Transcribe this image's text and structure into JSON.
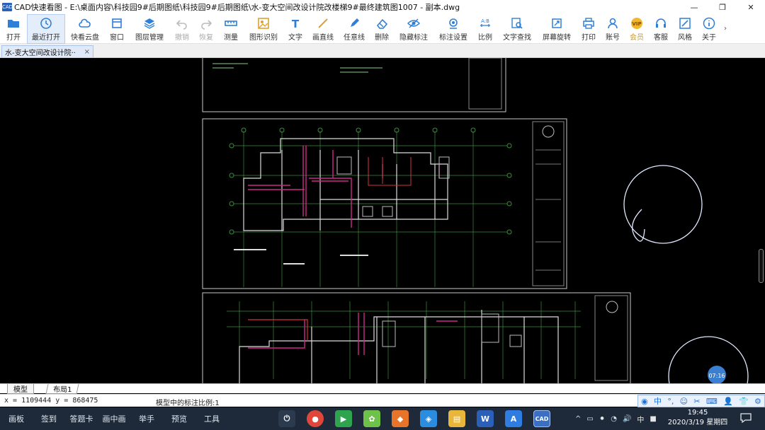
{
  "window": {
    "app_icon_label": "CAD",
    "title": "CAD快速看图 - E:\\桌面内容\\科技园9#后期图纸\\科技园9#后期图纸\\水-变大空间改设计院改楼梯9#最终建筑图1007 - 副本.dwg",
    "minimize": "—",
    "restore": "❐",
    "close": "✕"
  },
  "toolbar": {
    "items": [
      {
        "label": "打开",
        "icon": "folder-icon"
      },
      {
        "label": "最近打开",
        "icon": "clock-icon"
      },
      {
        "label": "快看云盘",
        "icon": "cloud-icon"
      },
      {
        "label": "窗口",
        "icon": "window-icon"
      },
      {
        "label": "图层管理",
        "icon": "layers-icon"
      },
      {
        "label": "撤销",
        "icon": "undo-icon"
      },
      {
        "label": "恢复",
        "icon": "redo-icon"
      },
      {
        "label": "测量",
        "icon": "ruler-icon"
      },
      {
        "label": "图形识别",
        "icon": "shape-recognize-icon"
      },
      {
        "label": "文字",
        "icon": "text-icon"
      },
      {
        "label": "画直线",
        "icon": "line-icon"
      },
      {
        "label": "任意线",
        "icon": "pen-icon"
      },
      {
        "label": "删除",
        "icon": "eraser-icon"
      },
      {
        "label": "隐藏标注",
        "icon": "eye-hide-icon"
      },
      {
        "label": "标注设置",
        "icon": "annotation-settings-icon"
      },
      {
        "label": "比例",
        "icon": "scale-icon"
      },
      {
        "label": "文字查找",
        "icon": "text-search-icon"
      },
      {
        "label": "屏幕旋转",
        "icon": "rotate-screen-icon"
      },
      {
        "label": "打印",
        "icon": "printer-icon"
      },
      {
        "label": "账号",
        "icon": "user-icon"
      },
      {
        "label": "会员",
        "icon": "vip-icon"
      },
      {
        "label": "客服",
        "icon": "headset-icon"
      },
      {
        "label": "风格",
        "icon": "style-icon"
      },
      {
        "label": "关于",
        "icon": "info-icon"
      }
    ],
    "more": "›",
    "scale_badge": "A:B",
    "vip_badge": "VIP",
    "text_glyph": "T"
  },
  "doc_tab": {
    "label": "水-变大空间改设计院··",
    "close": "×"
  },
  "layout_tabs": {
    "model": "模型",
    "layout1": "布局1"
  },
  "status": {
    "coords": "x = 1109444  y = 868475",
    "scale_text": "模型中的标注比例:1"
  },
  "ime_bar": {
    "lang": "中",
    "punct": "°,",
    "emoji": "☺"
  },
  "canvas": {
    "badge": "07:16"
  },
  "taskbar": {
    "items": [
      "画板",
      "签到",
      "答题卡",
      "画中画",
      "举手",
      "预览",
      "工具"
    ],
    "apps": [
      {
        "name": "power",
        "glyph": "⏻",
        "color": "#2b3a4f"
      },
      {
        "name": "chrome",
        "glyph": "●",
        "color": "#e0463a"
      },
      {
        "name": "media",
        "glyph": "▶",
        "color": "#2ea44f"
      },
      {
        "name": "flower",
        "glyph": "✿",
        "color": "#6ec24a"
      },
      {
        "name": "app-orange",
        "glyph": "◆",
        "color": "#e8742a"
      },
      {
        "name": "app-blue",
        "glyph": "◈",
        "color": "#2b8de0"
      },
      {
        "name": "explorer",
        "glyph": "▤",
        "color": "#e8b63a"
      },
      {
        "name": "word",
        "glyph": "W",
        "color": "#2b5fb8"
      },
      {
        "name": "app-a",
        "glyph": "A",
        "color": "#2f7de0"
      },
      {
        "name": "cad",
        "glyph": "CAD",
        "color": "#3a6fc4"
      }
    ],
    "tray": [
      "^",
      "▭",
      "⚫",
      "◔",
      "🔊",
      "中",
      "■"
    ],
    "time": "19:45",
    "date": "2020/3/19 星期四"
  }
}
